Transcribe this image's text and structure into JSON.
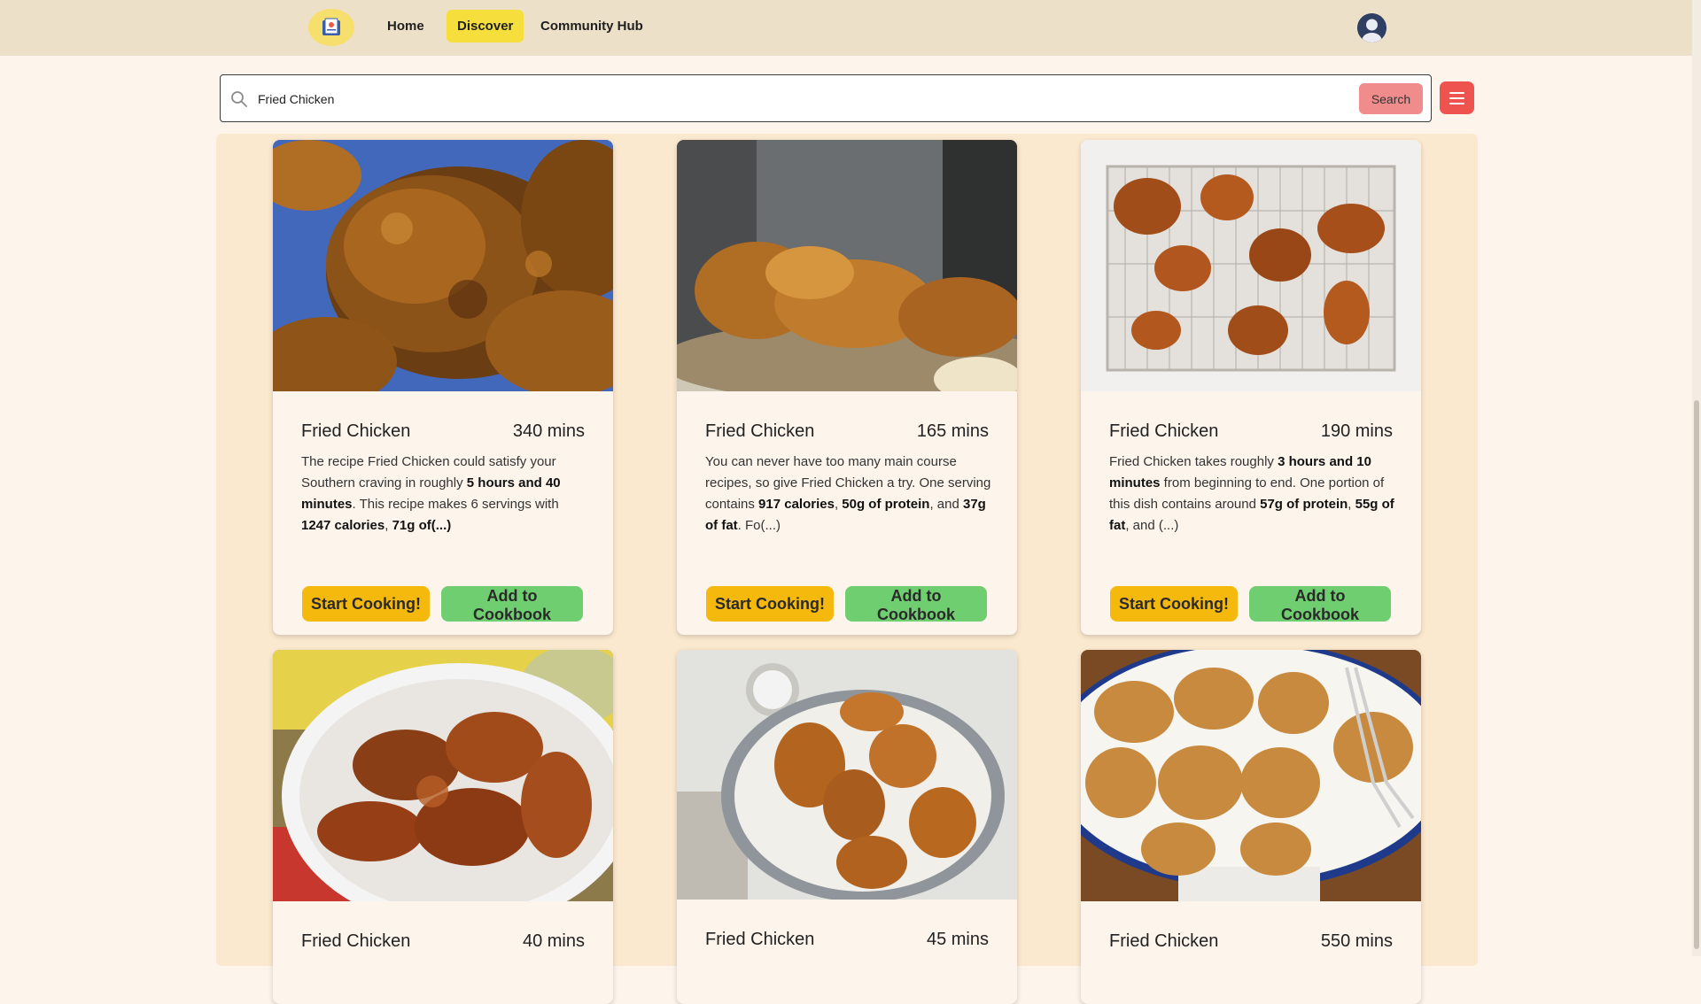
{
  "nav": {
    "links": [
      {
        "label": "Home"
      },
      {
        "label": "Discover",
        "active": true
      },
      {
        "label": "Community Hub"
      }
    ]
  },
  "search": {
    "value": "Fried Chicken",
    "button_label": "Search"
  },
  "labels": {
    "start_cooking": "Start Cooking!",
    "add_cookbook": "Add to Cookbook"
  },
  "recipes": [
    {
      "title": "Fried Chicken",
      "time": "340 mins",
      "description": [
        {
          "t": "The recipe Fried Chicken could satisfy your Southern craving in roughly "
        },
        {
          "t": "5 hours and 40 minutes",
          "b": true
        },
        {
          "t": ". This recipe makes 6 servings with "
        },
        {
          "t": "1247 calories",
          "b": true
        },
        {
          "t": ", "
        },
        {
          "t": "71g of(...)",
          "b": true
        }
      ]
    },
    {
      "title": "Fried Chicken",
      "time": "165 mins",
      "description": [
        {
          "t": "You can never have too many main course recipes, so give Fried Chicken a try. One serving contains "
        },
        {
          "t": "917 calories",
          "b": true
        },
        {
          "t": ", "
        },
        {
          "t": "50g of protein",
          "b": true
        },
        {
          "t": ", and "
        },
        {
          "t": "37g of fat",
          "b": true
        },
        {
          "t": ". Fo(...)"
        }
      ]
    },
    {
      "title": "Fried Chicken",
      "time": "190 mins",
      "description": [
        {
          "t": "Fried Chicken takes roughly "
        },
        {
          "t": "3 hours and 10 minutes",
          "b": true
        },
        {
          "t": " from beginning to end. One portion of this dish contains around "
        },
        {
          "t": "57g of protein",
          "b": true
        },
        {
          "t": ", "
        },
        {
          "t": "55g of fat",
          "b": true
        },
        {
          "t": ", and (...)"
        }
      ]
    },
    {
      "title": "Fried Chicken",
      "time": "40 mins",
      "description": []
    },
    {
      "title": "Fried Chicken",
      "time": "45 mins",
      "description": []
    },
    {
      "title": "Fried Chicken",
      "time": "550 mins",
      "description": []
    }
  ],
  "colors": {
    "nav_bg": "#ede0c9",
    "page_bg": "#fdf5ec",
    "content_bg": "#fbe9cf",
    "active_link": "#f6df3c",
    "search_button": "#f08c8c",
    "menu_button": "#ef5350",
    "cook_button": "#f5b90d",
    "cookbook_button": "#6fce6f"
  },
  "icons": {
    "logo": "book-logo-icon",
    "avatar": "user-avatar-icon",
    "search": "search-icon",
    "menu": "hamburger-menu-icon"
  }
}
